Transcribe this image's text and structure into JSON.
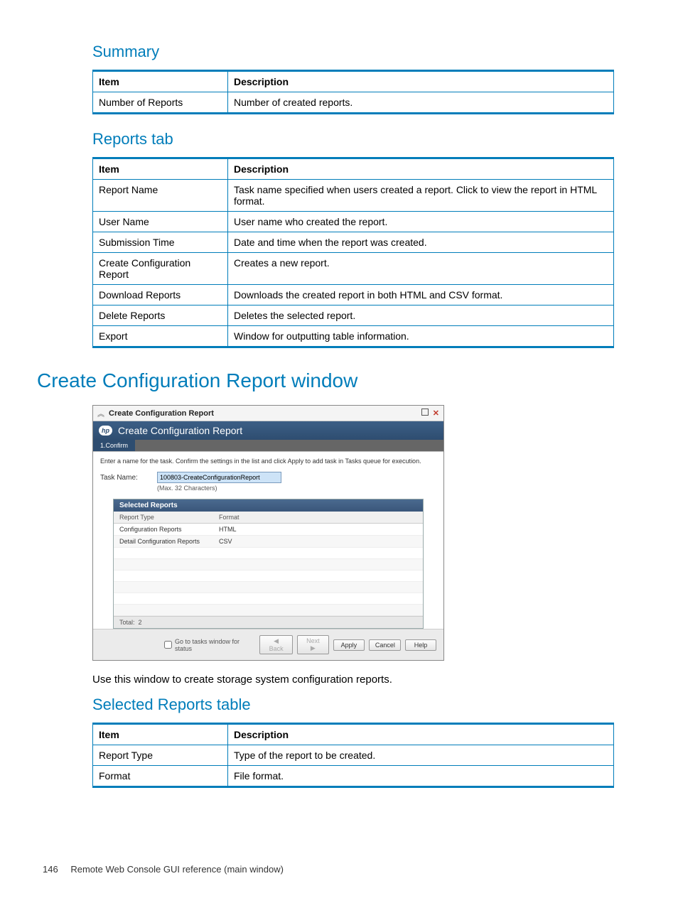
{
  "sections": {
    "summary_heading": "Summary",
    "reports_tab_heading": "Reports tab",
    "create_window_heading": "Create Configuration Report window",
    "selected_reports_heading": "Selected Reports table"
  },
  "summary_table": {
    "head_item": "Item",
    "head_desc": "Description",
    "rows": [
      {
        "item": "Number of Reports",
        "desc": "Number of created reports."
      }
    ]
  },
  "reports_table": {
    "head_item": "Item",
    "head_desc": "Description",
    "rows": [
      {
        "item": "Report Name",
        "desc": "Task name specified when users created a report. Click to view the report in HTML format."
      },
      {
        "item": "User Name",
        "desc": "User name who created the report."
      },
      {
        "item": "Submission Time",
        "desc": "Date and time when the report was created."
      },
      {
        "item": "Create Configuration Report",
        "desc": "Creates a new report."
      },
      {
        "item": "Download Reports",
        "desc": "Downloads the created report in both HTML and CSV format."
      },
      {
        "item": "Delete Reports",
        "desc": "Deletes the selected report."
      },
      {
        "item": "Export",
        "desc": "Window for outputting table information."
      }
    ]
  },
  "window": {
    "titlebar": "Create Configuration Report",
    "header": "Create Configuration Report",
    "badge": "hp",
    "step": "1.Confirm",
    "instruction": "Enter a name for the task. Confirm the settings in the list and click Apply to add task in Tasks queue for execution.",
    "task_label": "Task Name:",
    "task_value": "100803-CreateConfigurationReport",
    "task_hint": "(Max. 32 Characters)",
    "panel_title": "Selected Reports",
    "col_type": "Report Type",
    "col_format": "Format",
    "rows": [
      {
        "type": "Configuration Reports",
        "format": "HTML"
      },
      {
        "type": "Detail Configuration Reports",
        "format": "CSV"
      }
    ],
    "total_label": "Total:",
    "total_value": "2",
    "status_label": "Go to tasks window for status",
    "btn_back": "◀ Back",
    "btn_next": "Next ▶",
    "btn_apply": "Apply",
    "btn_cancel": "Cancel",
    "btn_help": "Help"
  },
  "body_text": "Use this window to create storage system configuration reports.",
  "selected_reports_table": {
    "head_item": "Item",
    "head_desc": "Description",
    "rows": [
      {
        "item": "Report Type",
        "desc": "Type of the report to be created."
      },
      {
        "item": "Format",
        "desc": "File format."
      }
    ]
  },
  "footer": {
    "page": "146",
    "title": "Remote Web Console GUI reference (main window)"
  }
}
